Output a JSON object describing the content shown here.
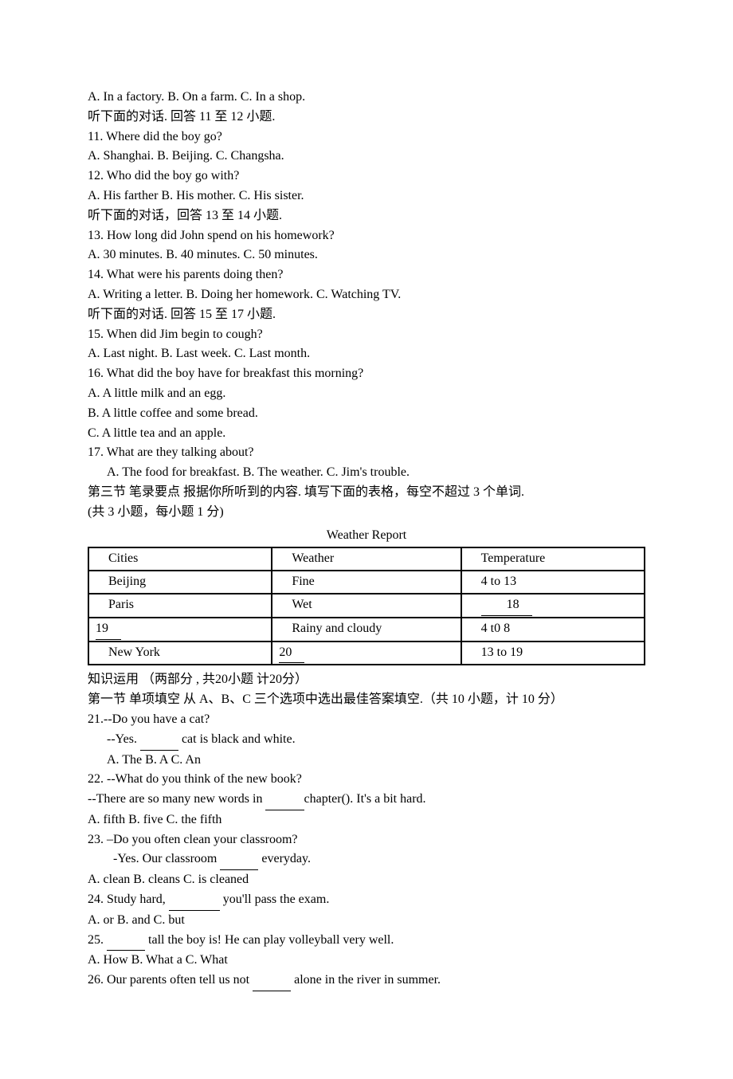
{
  "q10": {
    "opts": "A. In a factory.     B. On a  farm.  C. In a shop."
  },
  "pre11": "听下面的对话. 回答 11 至 12 小题.",
  "q11": {
    "stem": "11. Where did the boy go?",
    "opts": "A. Shanghai.    B. Beijing.   C. Changsha."
  },
  "q12": {
    "stem": "12. Who did the boy go with?",
    "opts": "A. His farther    B. His mother.  C. His sister."
  },
  "pre13": "听下面的对话，回答 13 至 14 小题.",
  "q13": {
    "stem": "13. How long did John spend on his homework?",
    "opts": "A. 30 minutes.    B. 40 minutes.   C. 50 minutes."
  },
  "q14": {
    "stem": "14. What were his parents doing then?",
    "opts": "A. Writing a letter.    B. Doing her homework.   C. Watching TV."
  },
  "pre15": "听下面的对话. 回答 15 至 17 小题.",
  "q15": {
    "stem": "15. When did Jim begin to cough?",
    "opts": "A. Last night.    B. Last week.   C. Last month."
  },
  "q16": {
    "stem": "16. What did the boy have for breakfast this morning?",
    "optA": "A. A little milk and an egg.",
    "optB": "B. A little coffee and some bread.",
    "optC": "C. A little tea and an apple."
  },
  "q17": {
    "stem": "17. What are they talking about?",
    "opts": "A. The food for breakfast.   B. The weather.    C. Jim's trouble."
  },
  "section3": {
    "title": "第三节 笔录要点 报据你所听到的内容. 填写下面的表格，每空不超过 3 个单词.",
    "score": "(共 3 小题，每小题 1 分)"
  },
  "table": {
    "title": "Weather Report",
    "head": {
      "c1": "Cities",
      "c2": "Weather",
      "c3": "Temperature"
    },
    "r1": {
      "c1": "Beijing",
      "c2": "Fine",
      "c3": "4 to 13"
    },
    "r2": {
      "c1": "Paris",
      "c2": "Wet",
      "c3a": "　",
      "c3b": "18",
      "c3c": "　"
    },
    "r3": {
      "c1a": " ",
      "c1b": "19",
      "c1c": "　",
      "c2": "Rainy and cloudy",
      "c3": "4 t0 8"
    },
    "r4": {
      "c1": "New York",
      "c2a": " ",
      "c2b": "20",
      "c2c": "　",
      "c3": "13 to 19"
    }
  },
  "knowledge": {
    "title": "知识运用 （两部分 , 共20小题 计20分）",
    "sub": "第一节 单项填空 从 A、B、C 三个选项中选出最佳答案填空.（共 10 小题，计 10 分）"
  },
  "q21": {
    "l1": "21.--Do you have a cat?",
    "l2a": "--Yes. ",
    "l2b": "　　　",
    "l2c": " cat is black and white.",
    "opts": "A. The     B. A      C. An"
  },
  "q22": {
    "l1": "22.  --What do you think of the new book?",
    "l2a": "--There are so many new words in ",
    "l2b": "　　　",
    "l2c": "chapter(). It's a bit hard.",
    "opts": "A. fifth         B. five          C. the fifth"
  },
  "q23": {
    "l1": "23. –Do you often clean your classroom?",
    "l2a": "-Yes. Our classroom ",
    "l2b": "　　　",
    "l2c": " everyday.",
    "opts": "A. clean       B. cleans        C. is cleaned"
  },
  "q24": {
    "l1a": "24. Study hard, ",
    "l1b": "　　　　",
    "l1c": " you'll pass the exam.",
    "opts": "A. or     B. and         C. but"
  },
  "q25": {
    "l1a": "25. ",
    "l1b": "　　　",
    "l1c": " tall the boy is! He can play volleyball very well.",
    "opts": "A. How       B. What  a         C. What"
  },
  "q26": {
    "l1a": "26. Our parents often tell us not ",
    "l1b": "　　　",
    "l1c": " alone in the river in summer."
  }
}
